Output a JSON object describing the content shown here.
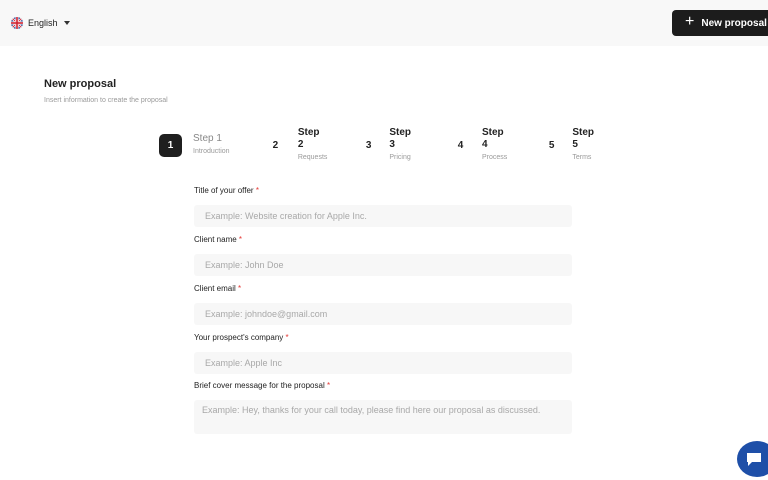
{
  "header": {
    "language": "English",
    "language_flag_icon": "uk-flag-icon",
    "new_proposal_label": "New proposal",
    "new_proposal_icon": "plus-icon"
  },
  "page": {
    "title": "New proposal",
    "subtitle": "Insert information to create the proposal"
  },
  "steps": [
    {
      "number": "1",
      "title": "Step 1",
      "desc": "Introduction",
      "active": true
    },
    {
      "number": "2",
      "title": "Step 2",
      "desc": "Requests",
      "active": false
    },
    {
      "number": "3",
      "title": "Step 3",
      "desc": "Pricing",
      "active": false
    },
    {
      "number": "4",
      "title": "Step 4",
      "desc": "Process",
      "active": false
    },
    {
      "number": "5",
      "title": "Step 5",
      "desc": "Terms",
      "active": false
    }
  ],
  "form": {
    "required_marker": "*",
    "fields": [
      {
        "label": "Title of your offer",
        "placeholder": "Example: Website creation for Apple Inc.",
        "value": ""
      },
      {
        "label": "Client name",
        "placeholder": "Example: John Doe",
        "value": ""
      },
      {
        "label": "Client email",
        "placeholder": "Example: johndoe@gmail.com",
        "value": ""
      },
      {
        "label": "Your prospect's company",
        "placeholder": "Example: Apple Inc",
        "value": ""
      },
      {
        "label": "Brief cover message for the proposal",
        "placeholder": "Example: Hey, thanks for your call today, please find here our proposal as discussed.",
        "value": ""
      }
    ]
  },
  "chat_widget": {
    "icon": "chat-bubble-icon"
  },
  "colors": {
    "primary_dark": "#1c1c1c",
    "required": "#e53935",
    "chat": "#1e4fa8",
    "input_bg": "#f7f7f7",
    "topbar_bg": "#f8f8f8"
  }
}
